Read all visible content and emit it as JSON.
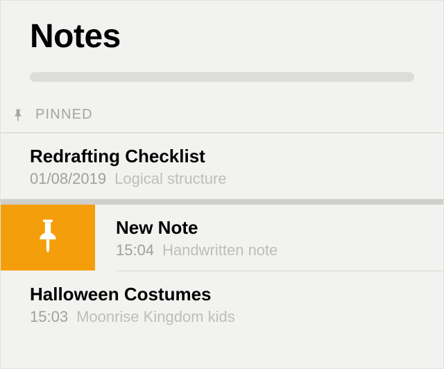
{
  "header": {
    "title": "Notes"
  },
  "sections": {
    "pinned_label": "PINNED",
    "pin_icon": "pin-icon"
  },
  "notes": {
    "pinned": [
      {
        "title": "Redrafting Checklist",
        "date": "01/08/2019",
        "preview": "Logical structure"
      }
    ],
    "others": [
      {
        "title": "New Note",
        "date": "15:04",
        "preview": "Handwritten note",
        "swiped": true
      },
      {
        "title": "Halloween Costumes",
        "date": "15:03",
        "preview": "Moonrise Kingdom kids",
        "swiped": false
      }
    ]
  },
  "colors": {
    "pin_action_bg": "#f59e0b",
    "background": "#f2f2f0"
  }
}
